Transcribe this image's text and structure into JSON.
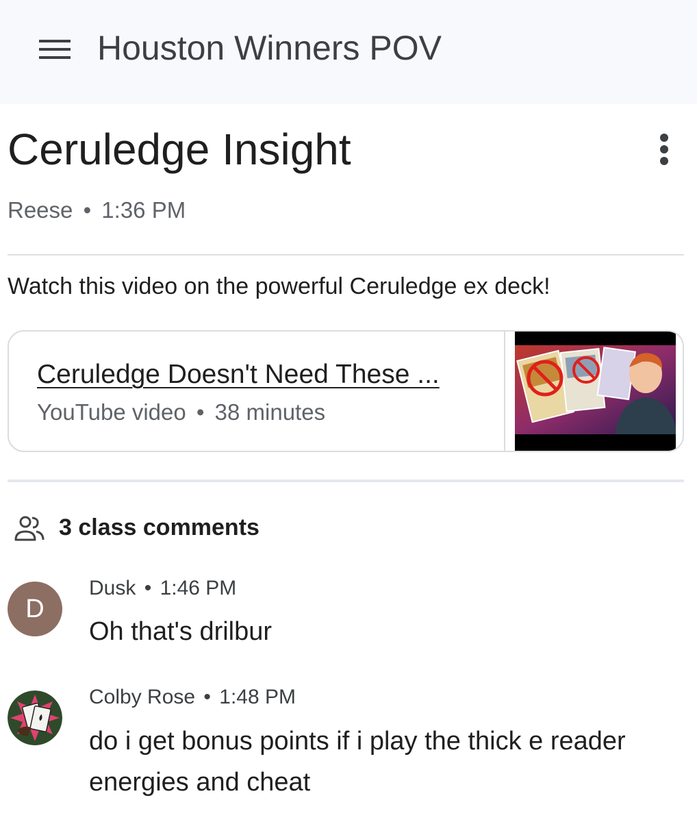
{
  "app_bar": {
    "menu_icon": "hamburger-menu-icon",
    "class_name": "Houston Winners POV"
  },
  "post": {
    "title": "Ceruledge Insight",
    "more_icon": "more-vert-icon",
    "author": "Reese",
    "separator": "•",
    "time": "1:36 PM",
    "body": "Watch this video on the powerful Ceruledge ex deck!"
  },
  "attachment": {
    "title": "Ceruledge Doesn't Need These ...",
    "type": "YouTube video",
    "separator": "•",
    "duration": "38 minutes",
    "thumbnail_icon": "video-thumbnail"
  },
  "comments": {
    "icon": "people-icon",
    "count_label": "3 class comments",
    "items": [
      {
        "avatar_letter": "D",
        "avatar_color": "#8d6e63",
        "author": "Dusk",
        "separator": "•",
        "time": "1:46 PM",
        "text": "Oh that's drilbur"
      },
      {
        "avatar_letter": "",
        "avatar_icon": "playing-cards-avatar",
        "author": "Colby Rose",
        "separator": "•",
        "time": "1:48 PM",
        "text": "do i get bonus points if i play the thick e reader energies and cheat"
      }
    ]
  },
  "colors": {
    "app_bar_bg": "#f8f9fc",
    "text_primary": "#1f1f1f",
    "text_secondary": "#5f6368",
    "divider": "#e0e0e0"
  }
}
